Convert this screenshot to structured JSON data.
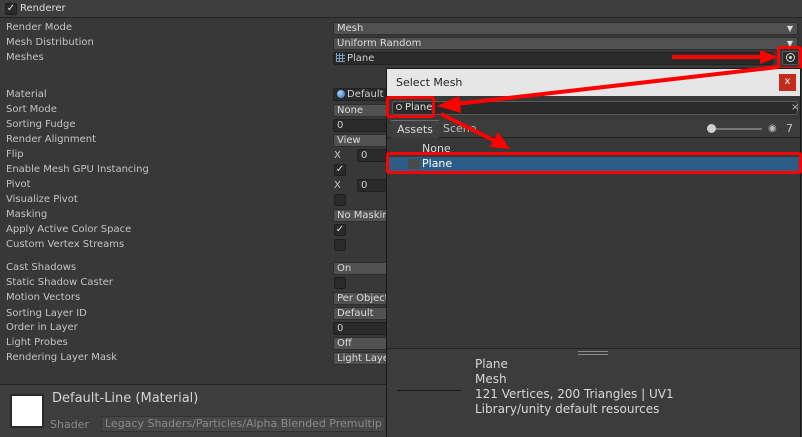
{
  "renderer": {
    "title": "Renderer"
  },
  "properties": [
    {
      "label": "Render Mode",
      "value": "Mesh",
      "kind": "dropdown"
    },
    {
      "label": "Mesh Distribution",
      "value": "Uniform Random",
      "kind": "dropdown"
    },
    {
      "label": "Meshes",
      "value": "Plane",
      "kind": "object"
    },
    {
      "label": "Material",
      "value": "Default",
      "kind": "object"
    },
    {
      "label": "Sort Mode",
      "value": "None",
      "kind": "dropdown"
    },
    {
      "label": "Sorting Fudge",
      "value": "0",
      "kind": "number"
    },
    {
      "label": "Render Alignment",
      "value": "View",
      "kind": "dropdown"
    },
    {
      "label": "Flip",
      "value": "0",
      "kind": "xvec",
      "axis": "X"
    },
    {
      "label": "Enable Mesh GPU Instancing",
      "kind": "toggle",
      "checked": true
    },
    {
      "label": "Pivot",
      "value": "0",
      "kind": "xvec",
      "axis": "X"
    },
    {
      "label": "Visualize Pivot",
      "kind": "toggle",
      "checked": false
    },
    {
      "label": "Masking",
      "value": "No Maskin",
      "kind": "dropdown"
    },
    {
      "label": "Apply Active Color Space",
      "kind": "toggle",
      "checked": true
    },
    {
      "label": "Custom Vertex Streams",
      "kind": "toggle",
      "checked": false
    },
    {
      "label": "Cast Shadows",
      "value": "On",
      "kind": "dropdown"
    },
    {
      "label": "Static Shadow Caster",
      "kind": "toggle",
      "checked": false
    },
    {
      "label": "Motion Vectors",
      "value": "Per Object",
      "kind": "dropdown"
    },
    {
      "label": "Sorting Layer ID",
      "value": "Default",
      "kind": "dropdown"
    },
    {
      "label": "Order in Layer",
      "value": "0",
      "kind": "number"
    },
    {
      "label": "Light Probes",
      "value": "Off",
      "kind": "dropdown"
    },
    {
      "label": "Rendering Layer Mask",
      "value": "Light Laye",
      "kind": "dropdown"
    }
  ],
  "material_preview": {
    "name": "Default-Line (Material)",
    "shader_label": "Shader",
    "shader_value": "Legacy Shaders/Particles/Alpha Blended Premultip"
  },
  "popup": {
    "title": "Select Mesh",
    "close": "x",
    "search_value": "Plane",
    "tabs": [
      "Assets",
      "Scene"
    ],
    "filter_count": "7",
    "items": [
      {
        "label": "None"
      },
      {
        "label": "Plane"
      }
    ],
    "details": [
      "Plane",
      "Mesh",
      "121 Vertices, 200 Triangles | UV1",
      "Library/unity default resources"
    ]
  },
  "colors": {
    "highlight": "#ff0000",
    "selection": "#2c5d87",
    "background": "#383838"
  },
  "icons": [
    "checkmark-icon",
    "mesh-icon",
    "material-icon",
    "object-picker-icon",
    "search-icon",
    "close-icon",
    "visibility-icon"
  ]
}
